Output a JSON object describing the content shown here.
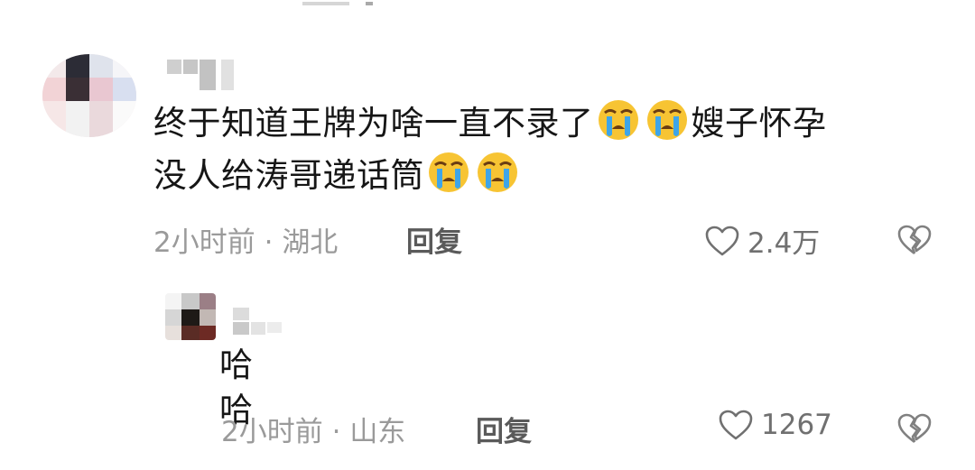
{
  "comment": {
    "text_part1": "终于知道王牌为啥一直不录了",
    "text_part2": "嫂子怀孕",
    "text_part3": "没人给涛哥递话筒",
    "time": "2小时前",
    "separator": "·",
    "location": "湖北",
    "reply_label": "回复",
    "likes": "2.4万"
  },
  "reply": {
    "text": "哈哈",
    "time": "2小时前",
    "separator": "·",
    "location": "山东",
    "reply_label": "回复",
    "likes": "1267"
  },
  "icons": {
    "emoji": "loudly-crying-face",
    "like": "heart-outline",
    "dislike": "broken-heart-outline"
  },
  "colors": {
    "text": "#161616",
    "meta": "#9a9a9a",
    "emoji_face": "#f7c433",
    "emoji_tears": "#3ea5e8"
  }
}
